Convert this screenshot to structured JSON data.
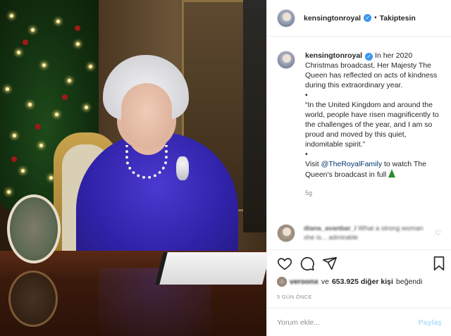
{
  "post": {
    "image_alt": "Queen at desk in front of Christmas tree"
  },
  "header": {
    "username": "kensingtonroyal",
    "separator": "•",
    "follow_state": "Takiptesin"
  },
  "caption": {
    "username": "kensingtonroyal",
    "line1": "In her 2020 Christmas broadcast, Her Majesty The Queen has reflected on acts of kindness during this extraordinary year.",
    "bullet1": "•",
    "quote": "“In the United Kingdom and around the world, people have risen magnificently to the challenges of the year, and I am so proud and moved by this quiet, indomitable spirit.”",
    "bullet2": "•",
    "visit_prefix": "Visit ",
    "mention": "@TheRoyalFamily",
    "visit_suffix": " to watch The Queen's broadcast in full ",
    "time_ago": "5g"
  },
  "comment": {
    "username": "diana_avanbar_i",
    "text": "What a strong woman she is... admirable"
  },
  "likes": {
    "liker": "veroonx",
    "mid": "ve",
    "count_text": "653.925 diğer kişi",
    "suffix": "beğendi"
  },
  "date_label": "5 GÜN ÖNCE",
  "comment_box": {
    "placeholder": "Yorum ekle...",
    "post_label": "Paylaş"
  },
  "colors": {
    "verified": "#3897f0",
    "mention": "#00376b",
    "post_button_disabled": "#b2dffc",
    "muted": "#8e8e8e"
  }
}
